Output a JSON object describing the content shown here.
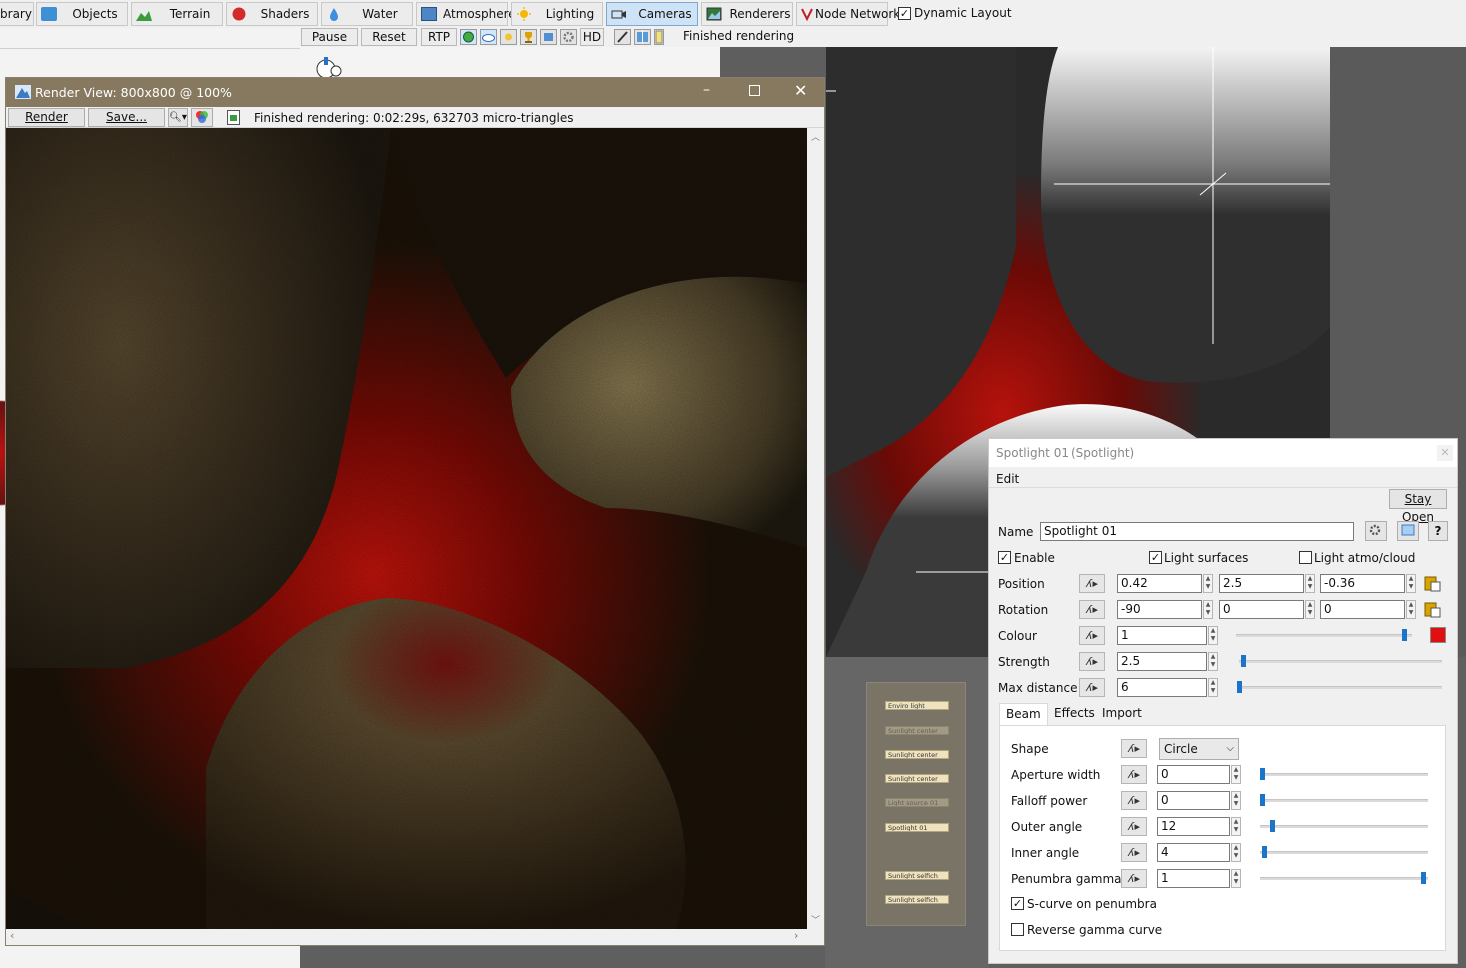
{
  "toolbar": {
    "buttons": [
      {
        "label": "brary",
        "icon": "library-icon"
      },
      {
        "label": "Objects",
        "icon": "cube-icon"
      },
      {
        "label": "Terrain",
        "icon": "terrain-icon"
      },
      {
        "label": "Shaders",
        "icon": "sphere-icon"
      },
      {
        "label": "Water",
        "icon": "water-drop-icon"
      },
      {
        "label": "Atmosphere",
        "icon": "sky-icon"
      },
      {
        "label": "Lighting",
        "icon": "sun-icon"
      },
      {
        "label": "Cameras",
        "icon": "camera-icon"
      },
      {
        "label": "Renderers",
        "icon": "render-icon"
      },
      {
        "label": "Node Network",
        "icon": "node-network-icon"
      }
    ],
    "dynamic_layout": "Dynamic Layout",
    "dynamic_layout_checked": true
  },
  "render_bar": {
    "pause": "Pause",
    "reset": "Reset",
    "rtp": "RTP",
    "hd": "HD",
    "status": "Finished rendering"
  },
  "render_window": {
    "title": "Render View: 800x800 @ 100%",
    "render_button": "Render",
    "save_button": "Save...",
    "status": "Finished rendering:  0:02:29s, 632703 micro-triangles"
  },
  "node_network": {
    "nodes": [
      {
        "label": "Enviro light",
        "dim": false
      },
      {
        "label": "Sunlight center",
        "dim": true
      },
      {
        "label": "Sunlight center",
        "dim": false
      },
      {
        "label": "Sunlight center",
        "dim": false
      },
      {
        "label": "Light source 01",
        "dim": true
      },
      {
        "label": "Spotlight 01",
        "dim": false
      },
      {
        "label": "Sunlight selfich",
        "dim": false
      },
      {
        "label": "Sunlight selfich",
        "dim": false
      }
    ]
  },
  "spotlight_panel": {
    "title": "Spotlight 01",
    "type": "(Spotlight)",
    "menu_edit": "Edit",
    "stay_open": "Stay Open",
    "name_label": "Name",
    "name_value": "Spotlight 01",
    "enable_label": "Enable",
    "enable_checked": true,
    "light_surfaces_label": "Light surfaces",
    "light_surfaces_checked": true,
    "light_atmo_label": "Light atmo/cloud",
    "light_atmo_checked": false,
    "position_label": "Position",
    "position_values": [
      "0.42",
      "2.5",
      "-0.36"
    ],
    "rotation_label": "Rotation",
    "rotation_values": [
      "-90",
      "0",
      "0"
    ],
    "colour_label": "Colour",
    "colour_value": "1",
    "colour_level": 0.97,
    "colour_swatch": "#e01010",
    "strength_label": "Strength",
    "strength_value": "2.5",
    "strength_level": 0.01,
    "max_distance_label": "Max distance",
    "max_distance_value": "6",
    "max_distance_level": 0.0,
    "tabs": [
      "Beam",
      "Effects",
      "Import"
    ],
    "beam": {
      "shape_label": "Shape",
      "shape_value": "Circle",
      "aperture_label": "Aperture width",
      "aperture_value": "0",
      "aperture_level": 0.0,
      "falloff_label": "Falloff power",
      "falloff_value": "0",
      "falloff_level": 0.0,
      "outer_angle_label": "Outer angle",
      "outer_angle_value": "12",
      "outer_angle_level": 0.06,
      "inner_angle_label": "Inner angle",
      "inner_angle_value": "4",
      "inner_angle_level": 0.01,
      "penumbra_label": "Penumbra gamma",
      "penumbra_value": "1",
      "penumbra_level": 0.99,
      "scurve_label": "S-curve on penumbra",
      "scurve_checked": true,
      "reverse_label": "Reverse gamma curve",
      "reverse_checked": false
    }
  },
  "colors": {
    "render_title_bar": "#86795f",
    "accent_blue": "#1a74c9",
    "active_tab": "#cfe3f7"
  }
}
